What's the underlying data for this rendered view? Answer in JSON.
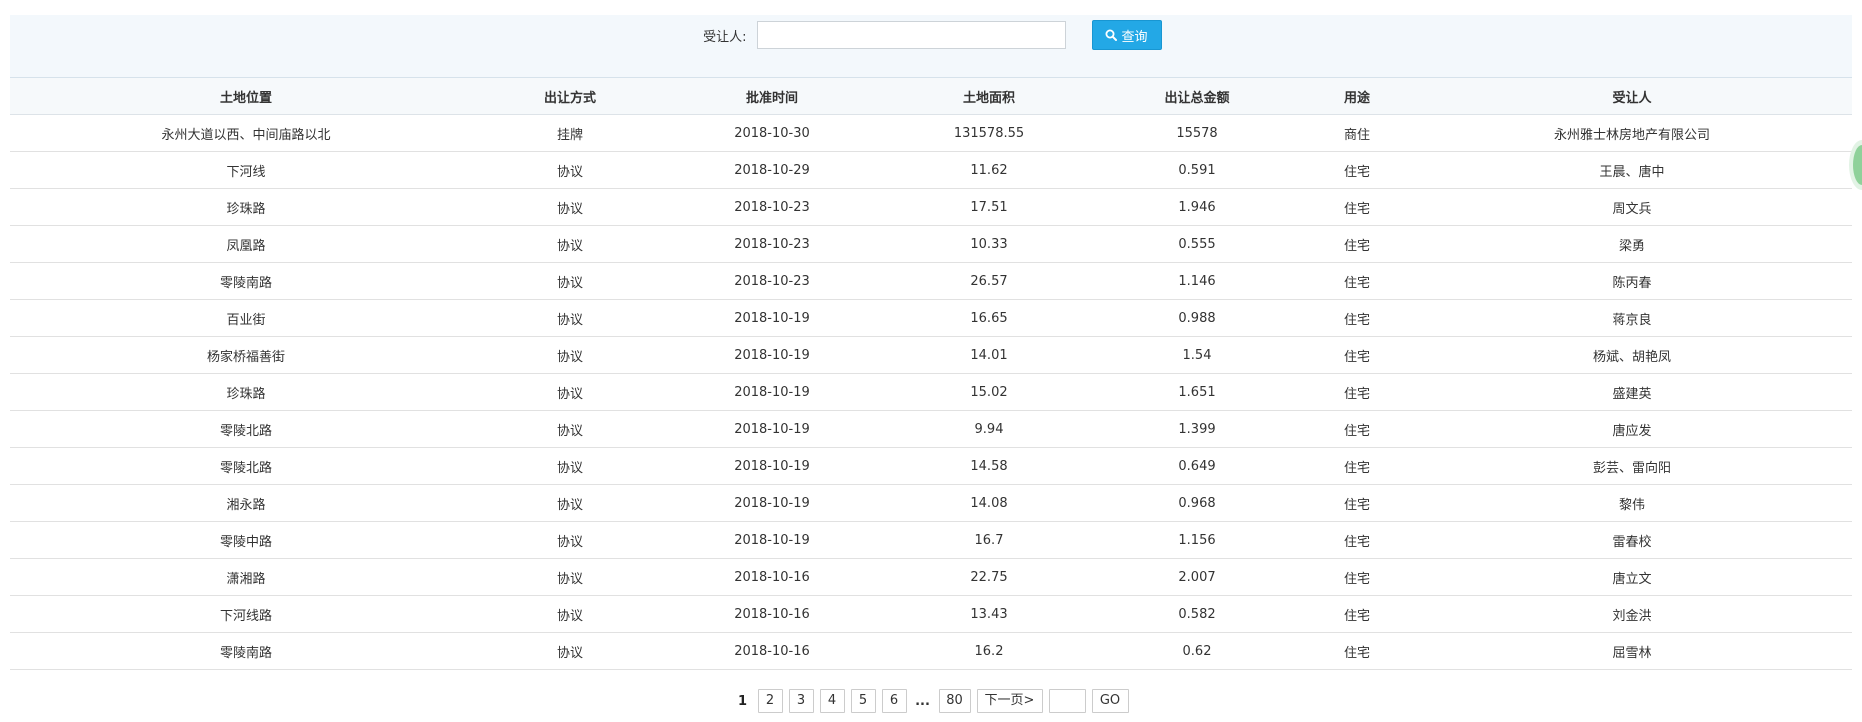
{
  "theme": {
    "accent": "#23a8e6",
    "accent_border": "#1896d2",
    "search_bg": "#f3f8fc",
    "header_bg": "#f6f9fb",
    "row_border": "#e1e1e1",
    "text": "#333333",
    "widget": "#8fd19a"
  },
  "search": {
    "label": "受让人:",
    "input_value": "",
    "button_label": "查询",
    "button_icon": "search-icon"
  },
  "table": {
    "columns": [
      "土地位置",
      "出让方式",
      "批准时间",
      "土地面积",
      "出让总金额",
      "用途",
      "受让人"
    ],
    "rows": [
      {
        "location": "永州大道以西、中间庙路以北",
        "method": "挂牌",
        "date": "2018-10-30",
        "area": 131578.55,
        "amount": 15578,
        "use": "商住",
        "transferee": "永州雅士林房地产有限公司"
      },
      {
        "location": "下河线",
        "method": "协议",
        "date": "2018-10-29",
        "area": 11.62,
        "amount": 0.591,
        "use": "住宅",
        "transferee": "王晨、唐中"
      },
      {
        "location": "珍珠路",
        "method": "协议",
        "date": "2018-10-23",
        "area": 17.51,
        "amount": 1.946,
        "use": "住宅",
        "transferee": "周文兵"
      },
      {
        "location": "凤凰路",
        "method": "协议",
        "date": "2018-10-23",
        "area": 10.33,
        "amount": 0.555,
        "use": "住宅",
        "transferee": "梁勇"
      },
      {
        "location": "零陵南路",
        "method": "协议",
        "date": "2018-10-23",
        "area": 26.57,
        "amount": 1.146,
        "use": "住宅",
        "transferee": "陈丙春"
      },
      {
        "location": "百业街",
        "method": "协议",
        "date": "2018-10-19",
        "area": 16.65,
        "amount": 0.988,
        "use": "住宅",
        "transferee": "蒋京良"
      },
      {
        "location": "杨家桥福善街",
        "method": "协议",
        "date": "2018-10-19",
        "area": 14.01,
        "amount": 1.54,
        "use": "住宅",
        "transferee": "杨斌、胡艳凤"
      },
      {
        "location": "珍珠路",
        "method": "协议",
        "date": "2018-10-19",
        "area": 15.02,
        "amount": 1.651,
        "use": "住宅",
        "transferee": "盛建英"
      },
      {
        "location": "零陵北路",
        "method": "协议",
        "date": "2018-10-19",
        "area": 9.94,
        "amount": 1.399,
        "use": "住宅",
        "transferee": "唐应发"
      },
      {
        "location": "零陵北路",
        "method": "协议",
        "date": "2018-10-19",
        "area": 14.58,
        "amount": 0.649,
        "use": "住宅",
        "transferee": "彭芸、雷向阳"
      },
      {
        "location": "湘永路",
        "method": "协议",
        "date": "2018-10-19",
        "area": 14.08,
        "amount": 0.968,
        "use": "住宅",
        "transferee": "黎伟"
      },
      {
        "location": "零陵中路",
        "method": "协议",
        "date": "2018-10-19",
        "area": 16.7,
        "amount": 1.156,
        "use": "住宅",
        "transferee": "雷春校"
      },
      {
        "location": "潇湘路",
        "method": "协议",
        "date": "2018-10-16",
        "area": 22.75,
        "amount": 2.007,
        "use": "住宅",
        "transferee": "唐立文"
      },
      {
        "location": "下河线路",
        "method": "协议",
        "date": "2018-10-16",
        "area": 13.43,
        "amount": 0.582,
        "use": "住宅",
        "transferee": "刘金洪"
      },
      {
        "location": "零陵南路",
        "method": "协议",
        "date": "2018-10-16",
        "area": 16.2,
        "amount": 0.62,
        "use": "住宅",
        "transferee": "屈雪林"
      }
    ]
  },
  "pagination": {
    "current": "1",
    "pages": [
      "2",
      "3",
      "4",
      "5",
      "6"
    ],
    "ellipsis": "...",
    "last_page": "80",
    "next_label": "下一页>",
    "jump_value": "",
    "go_label": "GO"
  }
}
